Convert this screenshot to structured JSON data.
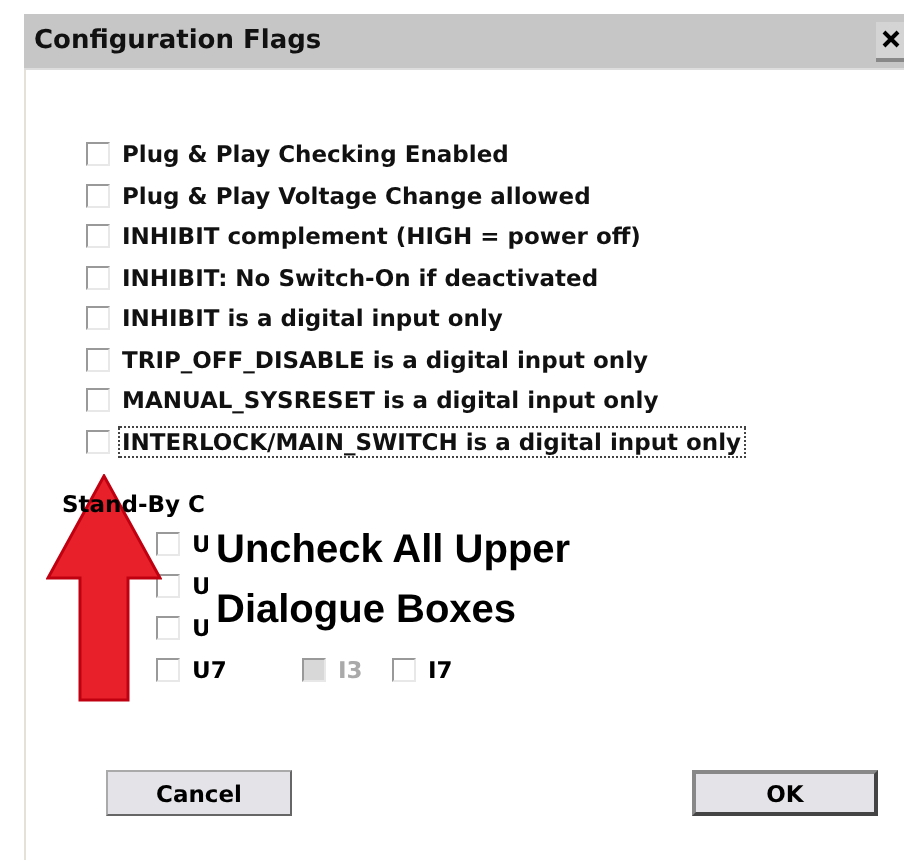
{
  "window": {
    "title": "Configuration Flags"
  },
  "flags": [
    {
      "label": "Plug & Play Checking Enabled",
      "checked": false,
      "focused": false
    },
    {
      "label": "Plug & Play Voltage Change allowed",
      "checked": false,
      "focused": false
    },
    {
      "label": "INHIBIT complement (HIGH = power off)",
      "checked": false,
      "focused": false
    },
    {
      "label": "INHIBIT: No Switch-On if deactivated",
      "checked": false,
      "focused": false
    },
    {
      "label": "INHIBIT is a digital input only",
      "checked": false,
      "focused": false
    },
    {
      "label": "TRIP_OFF_DISABLE is a digital input only",
      "checked": false,
      "focused": false
    },
    {
      "label": "MANUAL_SYSRESET is a digital input only",
      "checked": false,
      "focused": false
    },
    {
      "label": "INTERLOCK/MAIN_SWITCH is a digital input only",
      "checked": false,
      "focused": true
    }
  ],
  "standby": {
    "label": "Stand-By C",
    "rows": [
      {
        "items": [
          {
            "label": "U",
            "checked": false,
            "disabled": false
          }
        ]
      },
      {
        "items": [
          {
            "label": "U",
            "checked": false,
            "disabled": false
          }
        ]
      },
      {
        "items": [
          {
            "label": "U",
            "checked": false,
            "disabled": false
          }
        ]
      },
      {
        "items": [
          {
            "label": "U7",
            "checked": false,
            "disabled": false
          },
          {
            "label": "I3",
            "checked": false,
            "disabled": true
          },
          {
            "label": "I7",
            "checked": false,
            "disabled": false
          }
        ]
      }
    ]
  },
  "annotation": {
    "lines": [
      "Uncheck All Upper",
      "Dialogue Boxes"
    ]
  },
  "buttons": [
    {
      "label": "Cancel",
      "default": false
    },
    {
      "label": "OK",
      "default": true
    }
  ]
}
